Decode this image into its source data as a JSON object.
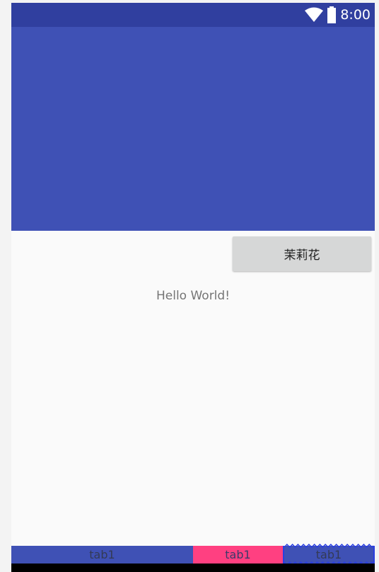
{
  "status_bar": {
    "time": "8:00",
    "wifi_icon": "wifi-icon",
    "battery_icon": "battery-icon"
  },
  "colors": {
    "status_bar": "#303f9f",
    "app_bar": "#3f51b5",
    "content_bg": "#fafafa",
    "tab_accent": "#ff4081",
    "button_bg": "#d6d7d7"
  },
  "main": {
    "button_label": "茉莉花",
    "hello_text": "Hello World!"
  },
  "tabs": [
    {
      "label": "tab1"
    },
    {
      "label": "tab1"
    },
    {
      "label": "tab1"
    }
  ]
}
